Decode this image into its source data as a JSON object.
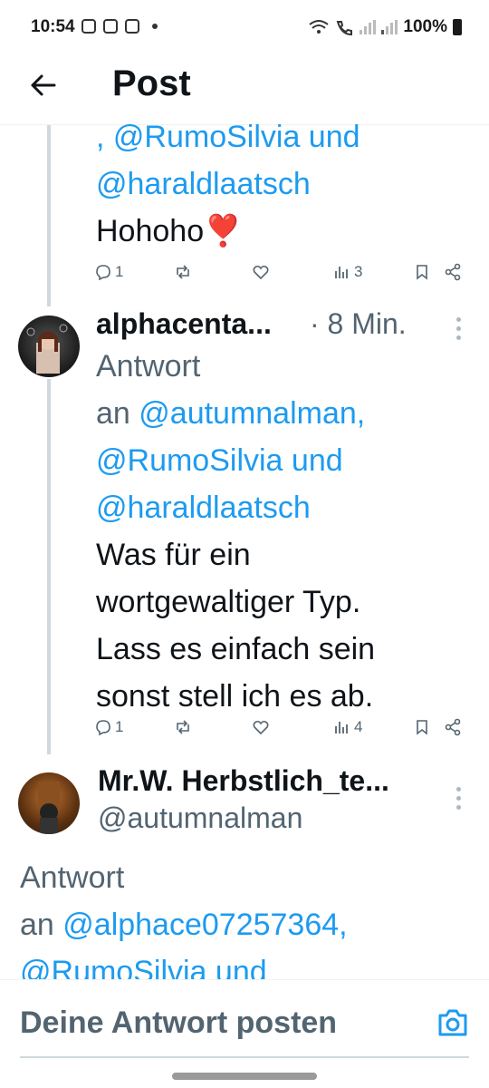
{
  "status_bar": {
    "time": "10:54",
    "battery": "100%"
  },
  "header": {
    "title": "Post",
    "back_icon": "arrow-left-icon"
  },
  "tweets": [
    {
      "mention_lines": [
        ", @RumoSilvia und",
        "@haraldlaatsch"
      ],
      "text": "Hohoho",
      "emoji": "❣️",
      "replies": "1",
      "views": "3"
    },
    {
      "name": "alphacenta...",
      "time": "· 8 Min.",
      "reply_label": "Antwort",
      "reply_an": "an ",
      "mention_1": "@autumnalman,",
      "mention_2": "@RumoSilvia und",
      "mention_3": "@haraldlaatsch",
      "text_lines": [
        "Was für ein",
        "wortgewaltiger Typ.",
        "Lass es einfach sein",
        "sonst stell ich es ab."
      ],
      "replies": "1",
      "views": "4"
    },
    {
      "name": "Mr.W. Herbstlich_te...",
      "handle": "@autumnalman",
      "reply_label": "Antwort",
      "reply_an": "an ",
      "mention_1": "@alphace07257364,",
      "mention_2": "@RumoSilvia und"
    }
  ],
  "reply_bar": {
    "placeholder": "Deine Antwort posten"
  },
  "colors": {
    "accent": "#1d9bf0",
    "text": "#0f1419",
    "muted": "#536471"
  }
}
